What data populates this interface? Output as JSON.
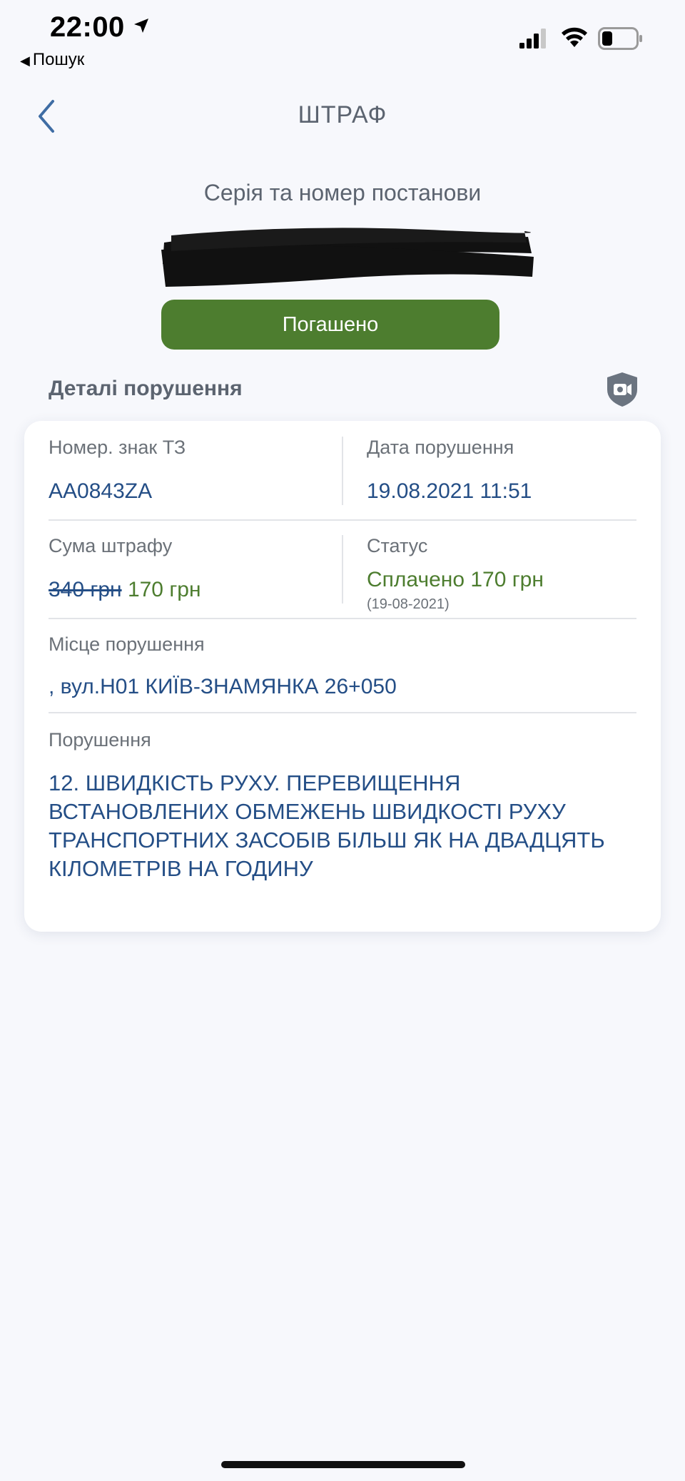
{
  "status_bar": {
    "time": "22:00",
    "back_app_label": "Пошук"
  },
  "header": {
    "title": "ШТРАФ"
  },
  "resolution": {
    "series_label": "Серія та номер постанови",
    "status_label": "Погашено"
  },
  "details": {
    "section_title": "Деталі порушення",
    "plate_label": "Номер. знак ТЗ",
    "plate_value": "AA0843ZA",
    "date_label": "Дата порушення",
    "date_value": "19.08.2021 11:51",
    "amount_label": "Сума штрафу",
    "amount_old": "340 грн",
    "amount_new": "170 грн",
    "status_label": "Статус",
    "status_value": "Сплачено 170 грн",
    "status_date": "(19-08-2021)",
    "place_label": "Місце порушення",
    "place_value": ", вул.Н01 КИЇВ-ЗНАМЯНКА 26+050",
    "violation_label": "Порушення",
    "violation_value": "12. ШВИДКІСТЬ РУХУ. ПЕРЕВИЩЕННЯ ВСТАНОВЛЕНИХ ОБМЕЖЕНЬ ШВИДКОСТІ РУХУ ТРАНСПОРТНИХ ЗАСОБІВ БІЛЬШ ЯК НА ДВАДЦЯТЬ КІЛОМЕТРІВ НА ГОДИНУ"
  },
  "icons": {
    "location": "location-arrow-icon",
    "signal": "cellular-signal-icon",
    "wifi": "wifi-icon",
    "battery": "battery-icon",
    "back": "chevron-left-icon",
    "camera": "camera-shield-icon"
  },
  "colors": {
    "accent_blue": "#244e86",
    "paid_green": "#4d7d2f",
    "background": "#f7f8fc"
  }
}
